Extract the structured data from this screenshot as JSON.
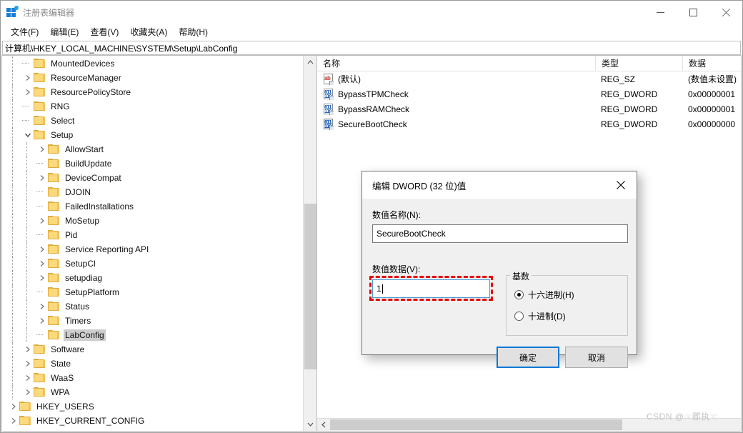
{
  "window": {
    "title": "注册表编辑器",
    "icon": "registry-icon",
    "controls": {
      "minimize": "minimize-icon",
      "maximize": "maximize-icon",
      "close": "close-icon"
    }
  },
  "menubar": {
    "items": [
      {
        "label": "文件(F)"
      },
      {
        "label": "编辑(E)"
      },
      {
        "label": "查看(V)"
      },
      {
        "label": "收藏夹(A)"
      },
      {
        "label": "帮助(H)"
      }
    ]
  },
  "address": {
    "path": "计算机\\HKEY_LOCAL_MACHINE\\SYSTEM\\Setup\\LabConfig"
  },
  "tree": {
    "nodes": [
      {
        "label": "MountedDevices",
        "depth": 1,
        "expander": "none",
        "selected": false
      },
      {
        "label": "ResourceManager",
        "depth": 1,
        "expander": "collapsed",
        "selected": false
      },
      {
        "label": "ResourcePolicyStore",
        "depth": 1,
        "expander": "collapsed",
        "selected": false
      },
      {
        "label": "RNG",
        "depth": 1,
        "expander": "none",
        "selected": false
      },
      {
        "label": "Select",
        "depth": 1,
        "expander": "none",
        "selected": false
      },
      {
        "label": "Setup",
        "depth": 1,
        "expander": "expanded",
        "selected": false
      },
      {
        "label": "AllowStart",
        "depth": 2,
        "expander": "collapsed",
        "selected": false
      },
      {
        "label": "BuildUpdate",
        "depth": 2,
        "expander": "none",
        "selected": false
      },
      {
        "label": "DeviceCompat",
        "depth": 2,
        "expander": "collapsed",
        "selected": false
      },
      {
        "label": "DJOIN",
        "depth": 2,
        "expander": "none",
        "selected": false
      },
      {
        "label": "FailedInstallations",
        "depth": 2,
        "expander": "none",
        "selected": false
      },
      {
        "label": "MoSetup",
        "depth": 2,
        "expander": "collapsed",
        "selected": false
      },
      {
        "label": "Pid",
        "depth": 2,
        "expander": "none",
        "selected": false
      },
      {
        "label": "Service Reporting API",
        "depth": 2,
        "expander": "collapsed",
        "selected": false
      },
      {
        "label": "SetupCl",
        "depth": 2,
        "expander": "collapsed",
        "selected": false
      },
      {
        "label": "setupdiag",
        "depth": 2,
        "expander": "collapsed",
        "selected": false
      },
      {
        "label": "SetupPlatform",
        "depth": 2,
        "expander": "none",
        "selected": false
      },
      {
        "label": "Status",
        "depth": 2,
        "expander": "collapsed",
        "selected": false
      },
      {
        "label": "Timers",
        "depth": 2,
        "expander": "collapsed",
        "selected": false
      },
      {
        "label": "LabConfig",
        "depth": 2,
        "expander": "none",
        "selected": true
      },
      {
        "label": "Software",
        "depth": 1,
        "expander": "collapsed",
        "selected": false
      },
      {
        "label": "State",
        "depth": 1,
        "expander": "collapsed",
        "selected": false
      },
      {
        "label": "WaaS",
        "depth": 1,
        "expander": "collapsed",
        "selected": false
      },
      {
        "label": "WPA",
        "depth": 1,
        "expander": "collapsed",
        "selected": false
      },
      {
        "label": "HKEY_USERS",
        "depth": 0,
        "expander": "collapsed",
        "selected": false
      },
      {
        "label": "HKEY_CURRENT_CONFIG",
        "depth": 0,
        "expander": "collapsed",
        "selected": false
      }
    ]
  },
  "list": {
    "columns": [
      {
        "label": "名称"
      },
      {
        "label": "类型"
      },
      {
        "label": "数据"
      }
    ],
    "rows": [
      {
        "name": "(默认)",
        "type": "REG_SZ",
        "data": "(数值未设置)",
        "icon": "string-value-icon",
        "selected": false
      },
      {
        "name": "BypassTPMCheck",
        "type": "REG_DWORD",
        "data": "0x00000001",
        "icon": "binary-value-icon",
        "selected": false
      },
      {
        "name": "BypassRAMCheck",
        "type": "REG_DWORD",
        "data": "0x00000001",
        "icon": "binary-value-icon",
        "selected": false
      },
      {
        "name": "SecureBootCheck",
        "type": "REG_DWORD",
        "data": "0x00000000",
        "icon": "binary-value-icon",
        "selected": true
      }
    ]
  },
  "dialog": {
    "title": "编辑 DWORD (32 位)值",
    "close_icon": "close-icon",
    "name_label": "数值名称(N):",
    "name_value": "SecureBootCheck",
    "data_label": "数值数据(V):",
    "data_value": "1",
    "base_group_label": "基数",
    "radios": [
      {
        "label": "十六进制(H)",
        "selected": true
      },
      {
        "label": "十进制(D)",
        "selected": false
      }
    ],
    "ok_label": "确定",
    "cancel_label": "取消",
    "highlight_color": "#e60000"
  },
  "watermark": {
    "text": "CSDN @☞郡执☜"
  }
}
